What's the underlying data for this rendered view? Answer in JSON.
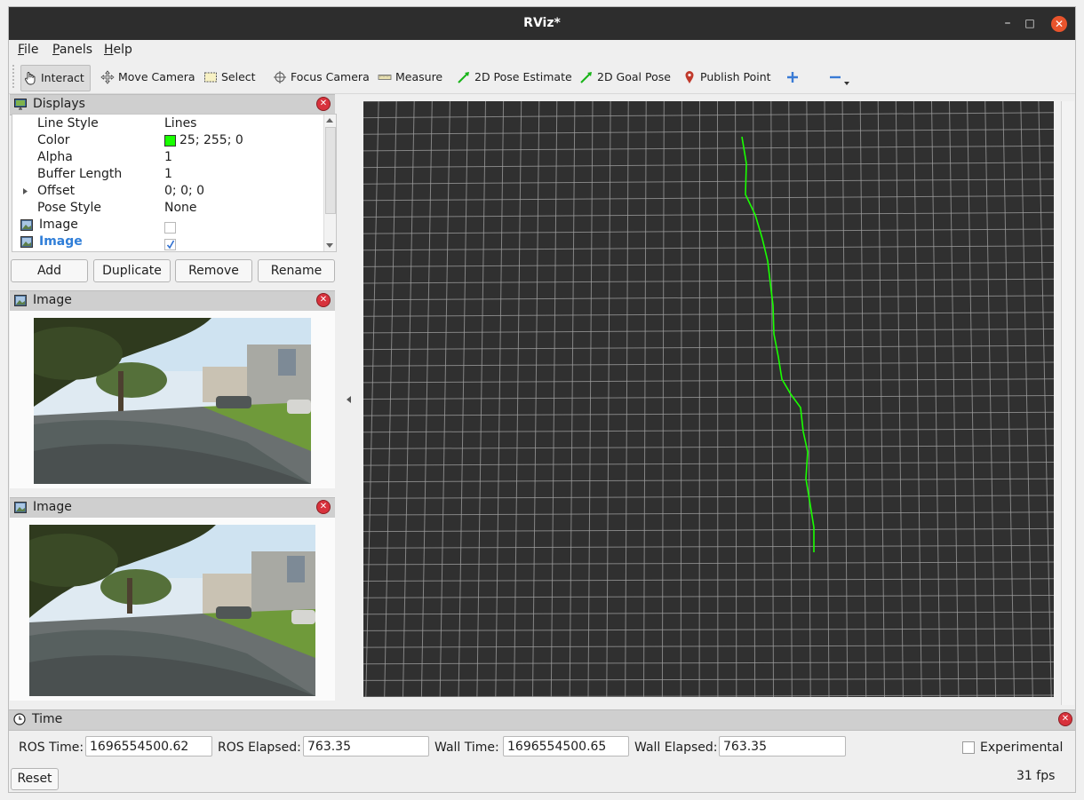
{
  "window": {
    "title": "RViz*"
  },
  "menu": [
    {
      "label": "File",
      "u": "F",
      "rest": "ile"
    },
    {
      "label": "Panels",
      "u": "P",
      "rest": "anels"
    },
    {
      "label": "Help",
      "u": "H",
      "rest": "elp"
    }
  ],
  "toolbar": {
    "interact": "Interact",
    "move_camera": "Move Camera",
    "select": "Select",
    "focus_camera": "Focus Camera",
    "measure": "Measure",
    "pose_estimate": "2D Pose Estimate",
    "goal_pose": "2D Goal Pose",
    "publish_point": "Publish Point"
  },
  "displays": {
    "title": "Displays",
    "rows": [
      {
        "key": "Line Style",
        "value": "Lines"
      },
      {
        "key": "Color",
        "value": "25; 255; 0",
        "swatch": "#19ff00"
      },
      {
        "key": "Alpha",
        "value": "1"
      },
      {
        "key": "Buffer Length",
        "value": "1"
      },
      {
        "key": "Offset",
        "value": "0; 0; 0"
      },
      {
        "key": "Pose Style",
        "value": "None"
      },
      {
        "key": "Image",
        "checked": false
      },
      {
        "key": "Image",
        "checked": true
      }
    ],
    "buttons": {
      "add": "Add",
      "duplicate": "Duplicate",
      "remove": "Remove",
      "rename": "Rename"
    }
  },
  "image_panels": [
    {
      "title": "Image"
    },
    {
      "title": "Image"
    }
  ],
  "path_color": "#19ff00",
  "time": {
    "title": "Time",
    "ros_time_label": "ROS Time:",
    "ros_time": "1696554500.62",
    "ros_elapsed_label": "ROS Elapsed:",
    "ros_elapsed": "763.35",
    "wall_time_label": "Wall Time:",
    "wall_time": "1696554500.65",
    "wall_elapsed_label": "Wall Elapsed:",
    "wall_elapsed": "763.35",
    "experimental": "Experimental",
    "reset": "Reset",
    "fps": "31 fps"
  }
}
